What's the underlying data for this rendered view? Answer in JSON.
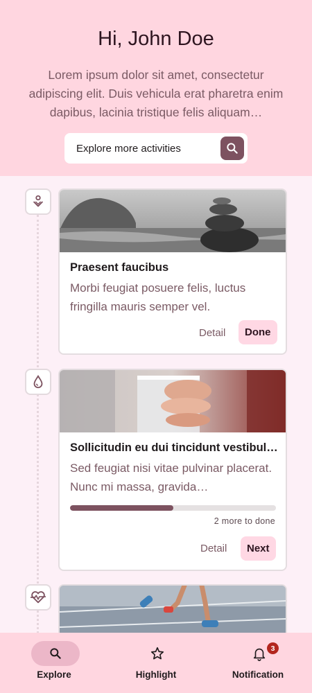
{
  "header": {
    "greeting": "Hi, John Doe",
    "intro": "Lorem ipsum dolor sit amet, consectetur adipiscing elit. Duis vehicula erat pharetra enim dapibus, lacinia tristique felis aliquam…",
    "search_label": "Explore more activities",
    "search_icon": "search-icon"
  },
  "timeline": [
    {
      "icon": "heart-person-icon",
      "title": "Praesent faucibus",
      "description": "Morbi feugiat posuere felis, luctus fringilla mauris semper vel.",
      "detail_label": "Detail",
      "action_label": "Done",
      "image": "stacked stones by the sea"
    },
    {
      "icon": "water-drop-icon",
      "title": "Sollicitudin eu dui tincidunt vestibul…",
      "description": "Sed feugiat nisi vitae pulvinar placerat. Nunc mi massa, gravida…",
      "progress": 0.5,
      "progress_text": "2 more to done",
      "detail_label": "Detail",
      "action_label": "Next",
      "image": "hand holding a glass of water"
    },
    {
      "icon": "heartbeat-icon",
      "image": "runner on a track"
    }
  ],
  "bottom_nav": {
    "items": [
      {
        "label": "Explore",
        "icon": "search-icon",
        "active": true
      },
      {
        "label": "Highlight",
        "icon": "star-icon",
        "active": false
      },
      {
        "label": "Notification",
        "icon": "bell-icon",
        "active": false,
        "badge": "3"
      }
    ]
  },
  "colors": {
    "header_bg": "#ffd6e0",
    "page_bg": "#fdf0f7",
    "accent": "#7d5260",
    "button_bg": "#ffd8e4",
    "badge": "#b3261e"
  }
}
